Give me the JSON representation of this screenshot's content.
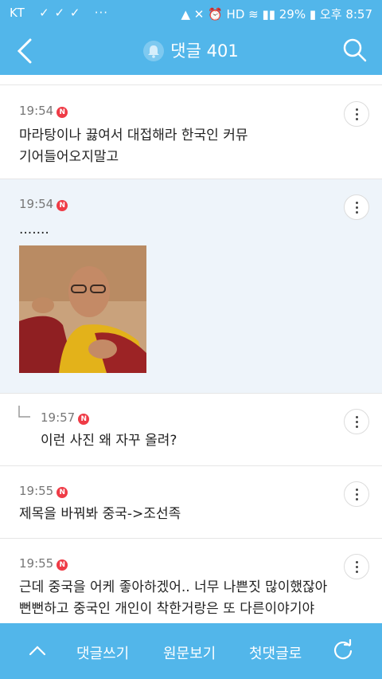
{
  "status_bar": {
    "carrier": "KT",
    "battery": "29%",
    "ampm": "오후",
    "time": "8:57"
  },
  "header": {
    "title": "댓글 401"
  },
  "comments": [
    {
      "time": "19:54",
      "badge": "N",
      "lines": [
        "마라탕이나 끓여서 대접해라 한국인 커뮤",
        "기어들어오지말고"
      ]
    },
    {
      "time": "19:54",
      "badge": "N",
      "lines": [
        "......."
      ],
      "has_image": true
    },
    {
      "time": "19:57",
      "badge": "N",
      "lines": [
        "이런 사진 왜 자꾸 올려?"
      ],
      "is_reply": true
    },
    {
      "time": "19:55",
      "badge": "N",
      "lines": [
        "제목을 바꿔봐 중국->조선족"
      ]
    },
    {
      "time": "19:55",
      "badge": "N",
      "lines": [
        "근데 중국을 어케 좋아하겠어.. 너무 나쁜짓 많이했잖아",
        "뻔뻔하고 중국인 개인이 착한거랑은 또 다른이야기야"
      ]
    }
  ],
  "bottom_bar": {
    "write_label": "댓글쓰기",
    "original_label": "원문보기",
    "first_label": "첫댓글로"
  },
  "colors": {
    "accent": "#52b6ea",
    "highlight_bg": "#eef4fa",
    "badge": "#ef3b46"
  }
}
